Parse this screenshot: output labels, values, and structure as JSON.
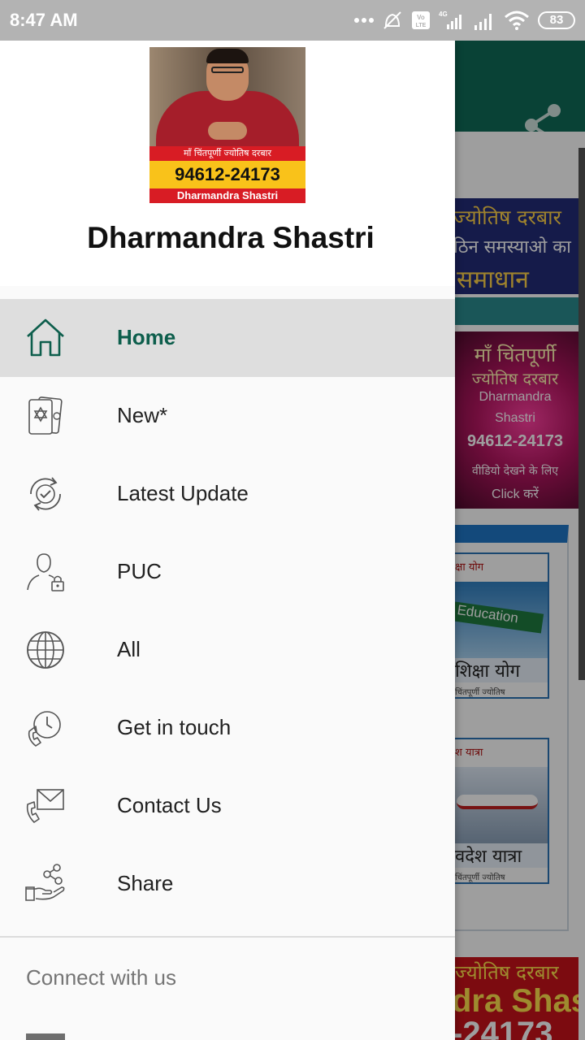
{
  "status_bar": {
    "time": "8:47 AM",
    "network_type": "4G",
    "volte": "Vo LTE",
    "battery": "83"
  },
  "background": {
    "toolbar_color": "#0f6b57",
    "banner_top": {
      "line1": "ज्योतिष दरबार",
      "line2": "ठिन समस्याओ का",
      "line3": "समाधान"
    },
    "banner_pink": {
      "line1": "माँ चिंतपूर्णी",
      "line2": "ज्योतिष दरबार",
      "name1": "Dharmandra",
      "name2": "Shastri",
      "phone": "94612-24173",
      "video_text": "वीडियो देखने के लिए",
      "click_text": "Click करें"
    },
    "cards": [
      {
        "title": "क्षा योग",
        "sign": "Education",
        "caption": "शिक्षा योग",
        "sub": "चिंतपूर्णी ज्योतिष"
      },
      {
        "title": "श यात्रा",
        "caption": "वदेश यात्रा",
        "sub": "चिंतपूर्णी ज्योतिष"
      }
    ],
    "banner_bottom": {
      "line1": "ज्योतिष दरबार",
      "line2": "dra Shastri",
      "line3": "-24173"
    }
  },
  "drawer": {
    "profile": {
      "image_band_top": "माँ चिंतपूर्णी ज्योतिष दरबार",
      "image_phone": "94612-24173",
      "image_band_bottom": "Dharmandra Shastri",
      "name": "Dharmandra Shastri"
    },
    "menu": [
      {
        "label": "Home",
        "icon": "home-icon",
        "active": true
      },
      {
        "label": "New*",
        "icon": "star-of-david-cards-icon",
        "active": false
      },
      {
        "label": "Latest Update",
        "icon": "refresh-check-icon",
        "active": false
      },
      {
        "label": "PUC",
        "icon": "user-lock-icon",
        "active": false
      },
      {
        "label": "All",
        "icon": "globe-icon",
        "active": false
      },
      {
        "label": "Get in touch",
        "icon": "phone-clock-icon",
        "active": false
      },
      {
        "label": "Contact Us",
        "icon": "phone-mail-icon",
        "active": false
      },
      {
        "label": "Share",
        "icon": "hand-share-icon",
        "active": false
      }
    ],
    "section_label": "Connect with us",
    "accent_color": "#0d5e4c"
  }
}
